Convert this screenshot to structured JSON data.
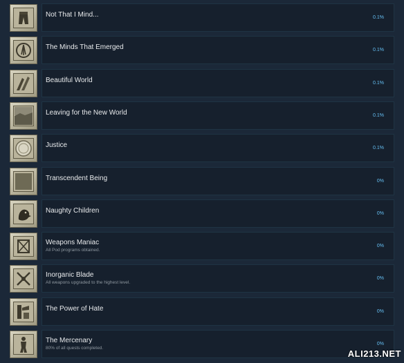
{
  "achievements": [
    {
      "title": "Not That I Mind...",
      "desc": "",
      "pct": "0.1%",
      "icon": "shorts-icon"
    },
    {
      "title": "The Minds That Emerged",
      "desc": "",
      "pct": "0.1%",
      "icon": "emblem-icon"
    },
    {
      "title": "Beautiful World",
      "desc": "",
      "pct": "0.1%",
      "icon": "wings-icon"
    },
    {
      "title": "Leaving for the New World",
      "desc": "",
      "pct": "0.1%",
      "icon": "landscape-icon"
    },
    {
      "title": "Justice",
      "desc": "",
      "pct": "0.1%",
      "icon": "seal-icon"
    },
    {
      "title": "Transcendent Being",
      "desc": "",
      "pct": "0%",
      "icon": "plain-tile-icon"
    },
    {
      "title": "Naughty Children",
      "desc": "",
      "pct": "0%",
      "icon": "bird-icon"
    },
    {
      "title": "Weapons Maniac",
      "desc": "All Pod programs obtained.",
      "pct": "0%",
      "icon": "pod-icon"
    },
    {
      "title": "Inorganic Blade",
      "desc": "All weapons upgraded to the highest level.",
      "pct": "0%",
      "icon": "crossed-blades-icon"
    },
    {
      "title": "The Power of Hate",
      "desc": "",
      "pct": "0%",
      "icon": "machine-icon"
    },
    {
      "title": "The Mercenary",
      "desc": "80% of all quests completed.",
      "pct": "0%",
      "icon": "figure-icon"
    }
  ],
  "watermark": "ALI213.NET"
}
